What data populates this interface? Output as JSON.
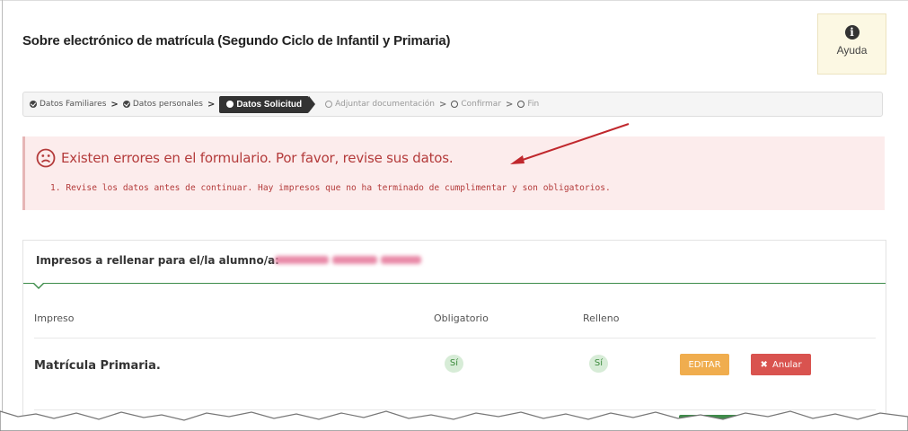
{
  "page": {
    "title": "Sobre electrónico de matrícula (Segundo Ciclo de Infantil y Primaria)"
  },
  "help": {
    "label": "Ayuda",
    "icon": "info-icon"
  },
  "wizard": {
    "steps": [
      {
        "label": "Datos Familiares",
        "state": "done"
      },
      {
        "label": "Datos personales",
        "state": "done"
      },
      {
        "label": "Datos Solicitud",
        "state": "active"
      },
      {
        "label": "Adjuntar documentación",
        "state": "pending"
      },
      {
        "label": "Confirmar",
        "state": "pending"
      },
      {
        "label": "Fin",
        "state": "pending"
      }
    ],
    "separator": "›"
  },
  "alert": {
    "icon": "sad-face-icon",
    "title": "Existen errores en el formulario. Por favor, revise sus datos.",
    "messages": [
      "1. Revise los datos antes de continuar. Hay impresos que no ha terminado de cumplimentar y son obligatorios."
    ],
    "color": "#b43b3b",
    "background": "#fcecec"
  },
  "panel": {
    "heading": "Impresos a rellenar para el/la alumno/a:",
    "columns": {
      "impreso": "Impreso",
      "obligatorio": "Obligatorio",
      "relleno": "Relleno"
    },
    "rows": [
      {
        "impreso": "Matrícula Primaria.",
        "obligatorio": "Sí",
        "relleno": "Sí",
        "edit_label": "EDITAR",
        "cancel_label": "Anular"
      }
    ]
  },
  "colors": {
    "accent_green": "#3c8c49",
    "edit_button": "#f0ad4e",
    "cancel_button": "#d9534f",
    "help_background": "#fcf8e3"
  }
}
